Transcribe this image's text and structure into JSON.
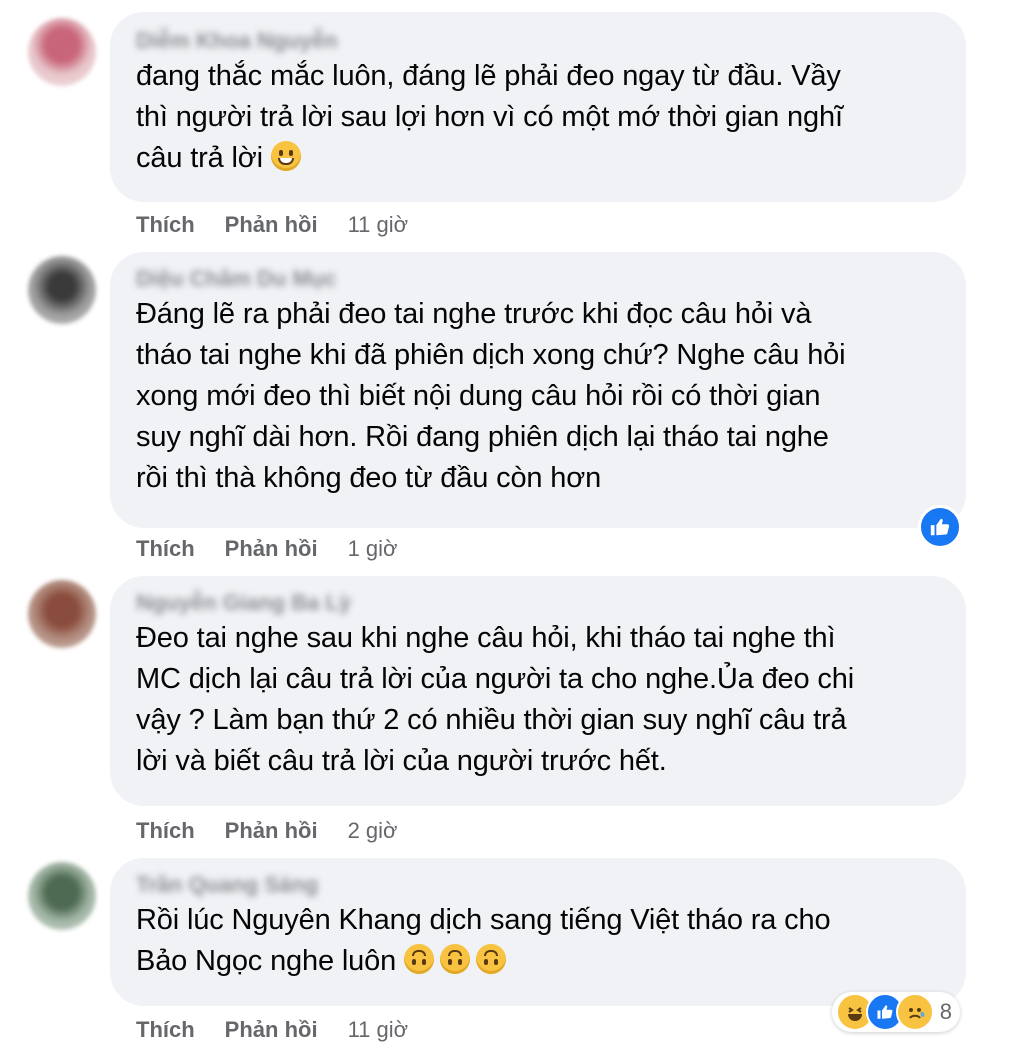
{
  "comments": [
    {
      "author": "Diễm Khoa Nguyễn",
      "lines": [
        "đang thắc mắc luôn, đáng lẽ phải đeo ngay từ đầu. Vầy",
        "thì người trả lời sau lợi hơn vì có một mớ thời gian nghĩ",
        "câu trả lời"
      ],
      "like": "Thích",
      "reply": "Phản hồi",
      "time": "11 giờ"
    },
    {
      "author": "Diệu Châm Du Mục",
      "lines": [
        "Đáng lẽ ra phải đeo tai nghe trước khi đọc câu hỏi và",
        "tháo tai nghe khi đã phiên dịch xong chứ? Nghe câu hỏi",
        "xong mới đeo thì biết nội dung câu hỏi rồi có thời gian",
        "suy nghĩ dài hơn. Rồi đang phiên dịch lại tháo tai nghe",
        "rồi thì thà không đeo từ đầu còn hơn"
      ],
      "like": "Thích",
      "reply": "Phản hồi",
      "time": "1 giờ"
    },
    {
      "author": "Nguyễn Giang Ba Lỳ",
      "lines": [
        "Đeo tai nghe sau khi nghe câu hỏi, khi tháo tai nghe thì",
        "MC dịch lại câu trả lời của người ta cho nghe.Ủa đeo chi",
        "vậy ? Làm bạn thứ 2 có nhiều thời gian suy nghĩ câu trả",
        "lời và biết câu trả lời của người trước hết."
      ],
      "like": "Thích",
      "reply": "Phản hồi",
      "time": "2 giờ"
    },
    {
      "author": "Trần Quang Sáng",
      "lines": [
        "Rồi lúc Nguyên Khang dịch sang tiếng Việt tháo ra cho",
        "Bảo Ngọc nghe luôn"
      ],
      "like": "Thích",
      "reply": "Phản hồi",
      "time": "11 giờ",
      "reaction_count": "8"
    }
  ],
  "colors": {
    "bubble": "#f0f2f5",
    "secondary_text": "#65676b",
    "like_blue": "#1877f2"
  },
  "icons": [
    "grinning-emoji",
    "upside-down-emoji",
    "like-reaction-icon",
    "haha-reaction-icon",
    "sad-reaction-icon"
  ]
}
